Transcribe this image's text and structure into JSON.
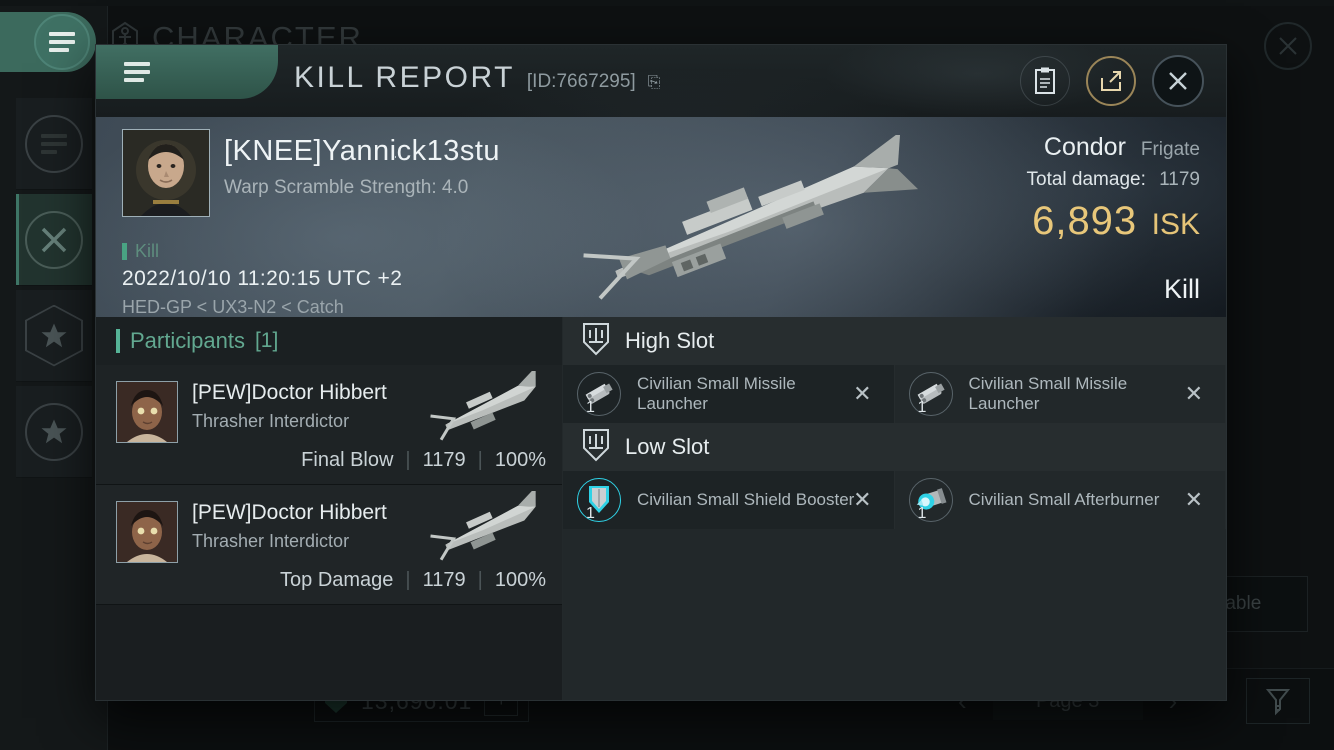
{
  "background": {
    "window_title": "CHARACTER",
    "window_title_icon": "character-icon",
    "close_icon": "close-icon",
    "menu_icon": "hamburger-menu-icon",
    "rail_items": [
      {
        "name": "sidebar-item-menu",
        "icon": "list-icon"
      },
      {
        "name": "sidebar-item-combat",
        "icon": "crossed-swords-icon"
      },
      {
        "name": "sidebar-item-standings",
        "icon": "hex-star-icon"
      },
      {
        "name": "sidebar-item-favorites",
        "icon": "circle-star-icon"
      }
    ],
    "isk_balance": "13,696.01",
    "isk_icon": "wallet-shield-icon",
    "isk_add_label": "+",
    "pager": {
      "prev_icon": "chevron-left-icon",
      "label": "Page 3",
      "next_icon": "chevron-right-icon"
    },
    "filter_icon": "funnel-filter-icon",
    "dispensable_label": "ensable"
  },
  "modal": {
    "menu_icon": "hamburger-menu-icon",
    "title": "KILL REPORT",
    "report_id": "[ID:7667295]",
    "copy_glyph": "⎘",
    "actions": [
      {
        "name": "copy-report-button",
        "icon": "clipboard-icon"
      },
      {
        "name": "share-report-button",
        "icon": "external-link-icon"
      },
      {
        "name": "close-modal-button",
        "icon": "close-icon"
      }
    ],
    "hero": {
      "victim_name": "[KNEE]Yannick13stu",
      "victim_sub": "Warp Scramble Strength: 4.0",
      "kill_tag": "Kill",
      "timestamp": "2022/10/10 11:20:15 UTC +2",
      "location": "HED-GP < UX3-N2 < Catch",
      "ship_name": "Condor",
      "ship_class": "Frigate",
      "total_damage_label": "Total damage:",
      "total_damage_value": "1179",
      "isk_value": "6,893",
      "isk_unit": "ISK",
      "verdict": "Kill",
      "portrait_name": "victim-portrait",
      "ship_render_name": "victim-ship-render"
    },
    "participants": {
      "title": "Participants",
      "count": "[1]",
      "rows": [
        {
          "name": "[PEW]Doctor Hibbert",
          "ship": "Thrasher Interdictor",
          "role": "Final Blow",
          "damage": "1179",
          "percent": "100%"
        },
        {
          "name": "[PEW]Doctor Hibbert",
          "ship": "Thrasher Interdictor",
          "role": "Top Damage",
          "damage": "1179",
          "percent": "100%"
        }
      ]
    },
    "fitting": {
      "groups": [
        {
          "title": "High Slot",
          "icon": "slot-shield-icon",
          "modules": [
            {
              "qty": "1",
              "name": "Civilian Small Missile Launcher",
              "icon": "missile-launcher-icon",
              "remove_glyph": "✕"
            },
            {
              "qty": "1",
              "name": "Civilian Small Missile Launcher",
              "icon": "missile-launcher-icon",
              "remove_glyph": "✕"
            }
          ]
        },
        {
          "title": "Low Slot",
          "icon": "slot-shield-icon",
          "modules": [
            {
              "qty": "1",
              "name": "Civilian Small Shield Booster",
              "icon": "shield-booster-icon",
              "remove_glyph": "✕"
            },
            {
              "qty": "1",
              "name": "Civilian Small Afterburner",
              "icon": "afterburner-icon",
              "remove_glyph": "✕"
            }
          ]
        }
      ]
    }
  },
  "colors": {
    "accent_teal": "#3f7164",
    "accent_gold": "#e8c77a",
    "participant_green": "#62a890",
    "text_primary": "#e9eff1"
  }
}
